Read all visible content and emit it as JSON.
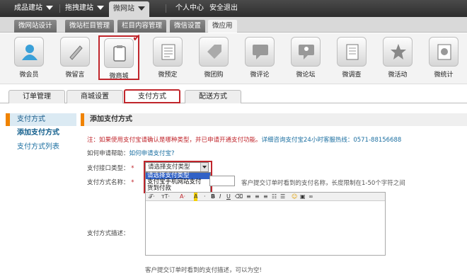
{
  "topnav": {
    "items": [
      {
        "label": "成品建站"
      },
      {
        "label": "拖拽建站"
      },
      {
        "label": "微网站"
      }
    ],
    "links": [
      "个人中心",
      "安全退出"
    ]
  },
  "subtabs": [
    "微网站设计",
    "微站栏目管理",
    "栏目内容管理",
    "微信设置",
    "微应用"
  ],
  "apps": [
    {
      "label": "微会员",
      "icon": "member-icon"
    },
    {
      "label": "微留言",
      "icon": "pen-icon"
    },
    {
      "label": "微商城",
      "icon": "clipboard-icon"
    },
    {
      "label": "微预定",
      "icon": "checklist-icon"
    },
    {
      "label": "微团购",
      "icon": "tag-icon"
    },
    {
      "label": "微评论",
      "icon": "speech-bubble-icon"
    },
    {
      "label": "微论坛",
      "icon": "forum-icon"
    },
    {
      "label": "微调查",
      "icon": "document-icon"
    },
    {
      "label": "微活动",
      "icon": "star-icon"
    },
    {
      "label": "微统计",
      "icon": "pie-chart-icon"
    }
  ],
  "ordertabs": [
    "订单管理",
    "商城设置",
    "支付方式",
    "配送方式"
  ],
  "sidebar": {
    "head": "支付方式",
    "items": [
      "添加支付方式",
      "支付方式列表"
    ]
  },
  "main": {
    "head": "添加支付方式",
    "notice_prefix": "注：如果使用支付宝请确认是哪种类型，并已申请开通支付功能。",
    "notice_link": "详细咨询支付宝24小时客服热线：0571-88156688",
    "help_label": "如何申请帮助：",
    "help_link": "如何申请支付宝?",
    "type_label": "支付接口类型：",
    "type_required": "*",
    "type_selected": "请选择支付类型",
    "type_options": [
      "请选择支付类型",
      "支付宝手机网站支付",
      "货到付款"
    ],
    "name_label": "支付方式名称：",
    "name_required": "*",
    "name_hint": "客户提交订单时看到的支付名称，长度限制在1-50个字符之间",
    "desc_label": "支付方式描述：",
    "desc_hint": "客户提交订单时看到的支付描述，可以为空!"
  }
}
